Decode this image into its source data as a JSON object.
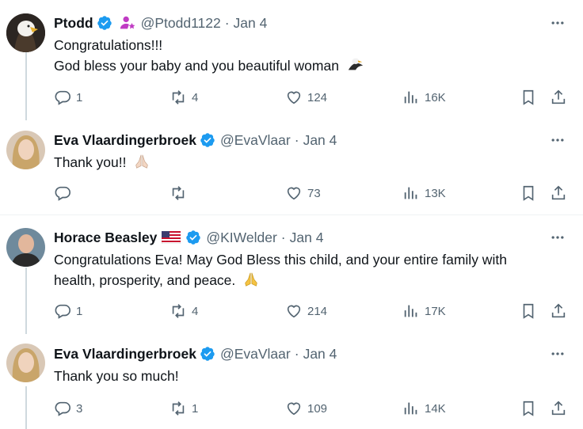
{
  "tweets": [
    {
      "name": "Ptodd",
      "handle": "@Ptodd1122",
      "sep": "·",
      "date": "Jan 4",
      "lines": [
        "Congratulations!!!",
        "God bless your baby and you beautiful woman"
      ],
      "emoji": "eagle",
      "replies": "1",
      "retweets": "4",
      "likes": "124",
      "views": "16K",
      "badge": "person-star-icon"
    },
    {
      "name": "Eva Vlaardingerbroek",
      "handle": "@EvaVlaar",
      "sep": "·",
      "date": "Jan 4",
      "lines": [
        "Thank you!!"
      ],
      "emoji": "praying-hands",
      "replies": "",
      "retweets": "",
      "likes": "73",
      "views": "13K"
    },
    {
      "name": "Horace Beasley",
      "handle": "@KIWelder",
      "sep": "·",
      "date": "Jan 4",
      "lines": [
        "Congratulations Eva! May God Bless this child, and your entire family with",
        "health, prosperity, and peace."
      ],
      "emoji": "praying-hands",
      "replies": "1",
      "retweets": "4",
      "likes": "214",
      "views": "17K",
      "flag": "us-flag-icon"
    },
    {
      "name": "Eva Vlaardingerbroek",
      "handle": "@EvaVlaar",
      "sep": "·",
      "date": "Jan 4",
      "lines": [
        "Thank you so much!"
      ],
      "replies": "3",
      "retweets": "1",
      "likes": "109",
      "views": "14K"
    }
  ],
  "colors": {
    "verified": "#1d9bf0",
    "muted": "#536471",
    "text": "#0f1419",
    "badge": "#c03bc4"
  }
}
